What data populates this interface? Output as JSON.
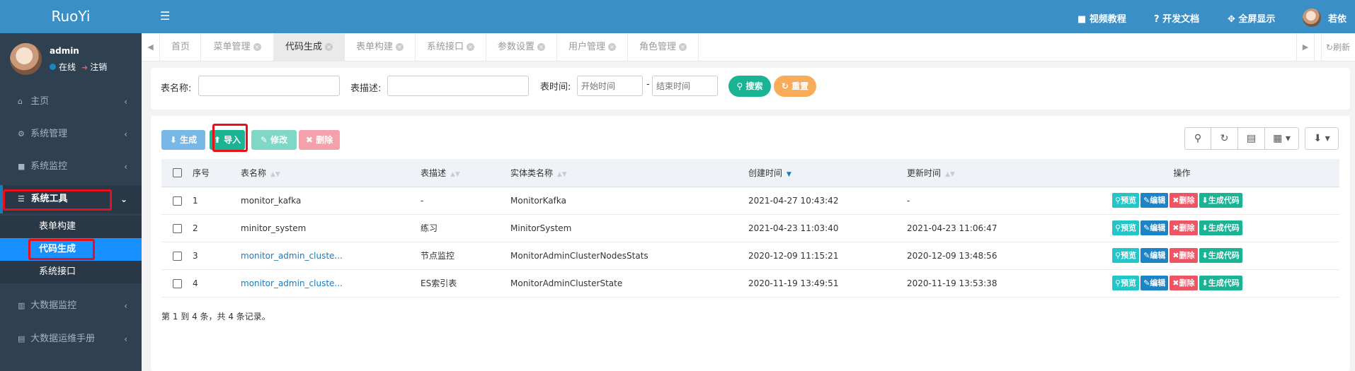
{
  "app": {
    "logo": "RuoYi"
  },
  "user": {
    "name": "admin",
    "status": "在线",
    "logout": "注销"
  },
  "topbar": {
    "video": "视频教程",
    "docs": "开发文档",
    "fullscreen": "全屏显示",
    "username": "若依"
  },
  "sidebar": {
    "items": [
      {
        "label": "主页",
        "icon": "home-icon"
      },
      {
        "label": "系统管理",
        "icon": "gear-icon"
      },
      {
        "label": "系统监控",
        "icon": "video-icon"
      },
      {
        "label": "系统工具",
        "icon": "bars-icon"
      },
      {
        "label": "大数据监控",
        "icon": "bank-icon"
      },
      {
        "label": "大数据运维手册",
        "icon": "book-icon"
      }
    ],
    "subitems": [
      "表单构建",
      "代码生成",
      "系统接口"
    ]
  },
  "tabs": [
    "首页",
    "菜单管理",
    "代码生成",
    "表单构建",
    "系统接口",
    "参数设置",
    "用户管理",
    "角色管理"
  ],
  "tab_refresh": "刷新",
  "search": {
    "table_name_label": "表名称:",
    "table_desc_label": "表描述:",
    "table_time_label": "表时间:",
    "start_placeholder": "开始时间",
    "end_placeholder": "结束时间",
    "range_sep": "-",
    "search_btn": "搜索",
    "reset_btn": "重置"
  },
  "toolbar": {
    "generate": "生成",
    "import": "导入",
    "edit": "修改",
    "delete": "删除"
  },
  "table": {
    "headers": [
      "序号",
      "表名称",
      "表描述",
      "实体类名称",
      "创建时间",
      "更新时间",
      "操作"
    ],
    "rows": [
      {
        "no": "1",
        "name": "monitor_kafka",
        "desc": "-",
        "entity": "MonitorKafka",
        "created": "2021-04-27 10:43:42",
        "updated": "-"
      },
      {
        "no": "2",
        "name": "minitor_system",
        "desc": "练习",
        "entity": "MinitorSystem",
        "created": "2021-04-23 11:03:40",
        "updated": "2021-04-23 11:06:47"
      },
      {
        "no": "3",
        "name": "monitor_admin_cluste...",
        "desc": "节点监控",
        "entity": "MonitorAdminClusterNodesStats",
        "created": "2020-12-09 11:15:21",
        "updated": "2020-12-09 13:48:56"
      },
      {
        "no": "4",
        "name": "monitor_admin_cluste...",
        "desc": "ES索引表",
        "entity": "MonitorAdminClusterState",
        "created": "2020-11-19 13:49:51",
        "updated": "2020-11-19 13:53:38"
      }
    ],
    "actions": {
      "preview": "预览",
      "edit": "编辑",
      "delete": "删除",
      "gen": "生成代码"
    }
  },
  "pagination": {
    "summary": "第 1 到 4 条，共 4 条记录。"
  },
  "colors": {
    "header_blue": "#3a8fc7",
    "sidebar_dark": "#2f4050",
    "highlight_red": "#e8111a"
  }
}
